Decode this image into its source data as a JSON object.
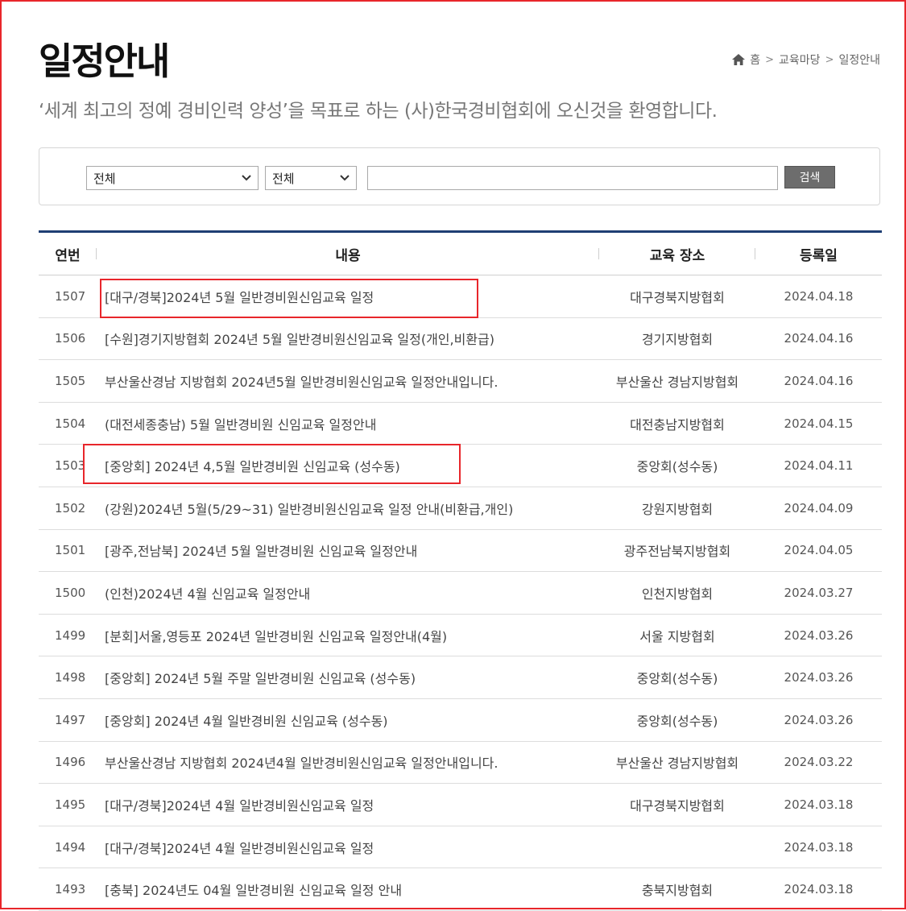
{
  "header": {
    "title": "일정안내",
    "subtitle": "‘세계 최고의 정예 경비인력 양성’을 목표로 하는 (사)한국경비협회에 오신것을 환영합니다."
  },
  "breadcrumb": {
    "items": [
      "홈",
      "교육마당",
      "일정안내"
    ],
    "home_icon": "home-icon"
  },
  "search": {
    "select1_value": "전체",
    "select2_value": "전체",
    "input_value": "",
    "button_label": "검색"
  },
  "table": {
    "headers": [
      "연번",
      "내용",
      "교육 장소",
      "등록일"
    ],
    "rows": [
      {
        "no": "1507",
        "content": "[대구/경북]2024년 5월 일반경비원신임교육 일정",
        "place": "대구경북지방협회",
        "date": "2024.04.18"
      },
      {
        "no": "1506",
        "content": "[수원]경기지방협회 2024년 5월 일반경비원신임교육 일정(개인,비환급)",
        "place": "경기지방협회",
        "date": "2024.04.16"
      },
      {
        "no": "1505",
        "content": "부산울산경남 지방협회 2024년5월 일반경비원신임교육 일정안내입니다.",
        "place": "부산울산 경남지방협회",
        "date": "2024.04.16"
      },
      {
        "no": "1504",
        "content": "(대전세종충남) 5월 일반경비원 신임교육 일정안내",
        "place": "대전충남지방협회",
        "date": "2024.04.15"
      },
      {
        "no": "1503",
        "content": "[중앙회] 2024년 4,5월 일반경비원 신임교육 (성수동)",
        "place": "중앙회(성수동)",
        "date": "2024.04.11"
      },
      {
        "no": "1502",
        "content": "(강원)2024년 5월(5/29~31) 일반경비원신임교육 일정 안내(비환급,개인)",
        "place": "강원지방협회",
        "date": "2024.04.09"
      },
      {
        "no": "1501",
        "content": "[광주,전남북] 2024년 5월 일반경비원 신임교육 일정안내",
        "place": "광주전남북지방협회",
        "date": "2024.04.05"
      },
      {
        "no": "1500",
        "content": "(인천)2024년 4월 신임교육 일정안내",
        "place": "인천지방협회",
        "date": "2024.03.27"
      },
      {
        "no": "1499",
        "content": "[분회]서울,영등포 2024년 일반경비원 신임교육 일정안내(4월)",
        "place": "서울 지방협회",
        "date": "2024.03.26"
      },
      {
        "no": "1498",
        "content": "[중앙회] 2024년 5월 주말 일반경비원 신임교육 (성수동)",
        "place": "중앙회(성수동)",
        "date": "2024.03.26"
      },
      {
        "no": "1497",
        "content": "[중앙회] 2024년 4월 일반경비원 신임교육 (성수동)",
        "place": "중앙회(성수동)",
        "date": "2024.03.26"
      },
      {
        "no": "1496",
        "content": "부산울산경남 지방협회 2024년4월 일반경비원신임교육 일정안내입니다.",
        "place": "부산울산 경남지방협회",
        "date": "2024.03.22"
      },
      {
        "no": "1495",
        "content": "[대구/경북]2024년 4월 일반경비원신임교육 일정",
        "place": "대구경북지방협회",
        "date": "2024.03.18"
      },
      {
        "no": "1494",
        "content": "[대구/경북]2024년 4월 일반경비원신임교육 일정",
        "place": "",
        "date": "2024.03.18"
      },
      {
        "no": "1493",
        "content": "[충북] 2024년도 04월 일반경비원 신임교육 일정 안내",
        "place": "충북지방협회",
        "date": "2024.03.18"
      }
    ]
  },
  "colors": {
    "highlight": "#e8262b",
    "table_top_border": "#1f3e73",
    "search_button": "#6d6d6d"
  }
}
